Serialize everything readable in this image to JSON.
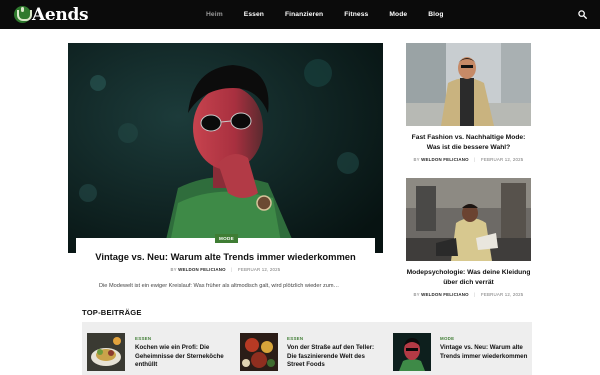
{
  "header": {
    "logo_text": "Aends",
    "nav": [
      "Heim",
      "Essen",
      "Finanzieren",
      "Fitness",
      "Mode",
      "Blog"
    ],
    "active_nav": "Heim"
  },
  "hero": {
    "category": "MODE",
    "title": "Vintage vs. Neu: Warum alte Trends immer wiederkommen",
    "author": "WELDON FELICIANO",
    "date": "FEBRUAR 12, 2025",
    "by": "BY",
    "excerpt": "Die Modewelt ist ein ewiger Kreislauf: Was früher als altmodisch galt, wird plötzlich wieder zum…"
  },
  "side_posts": [
    {
      "title": "Fast Fashion vs. Nachhaltige Mode: Was ist die bessere Wahl?",
      "by": "BY",
      "author": "WELDON FELICIANO",
      "date": "FEBRUAR 12, 2025"
    },
    {
      "title": "Modepsychologie: Was deine Kleidung über dich verrät",
      "by": "BY",
      "author": "WELDON FELICIANO",
      "date": "FEBRUAR 12, 2025"
    }
  ],
  "top_section": {
    "title": "TOP-BEITRÄGE",
    "items": [
      {
        "category": "ESSEN",
        "title": "Kochen wie ein Profi: Die Geheimnisse der Sterneköche enthüllt"
      },
      {
        "category": "ESSEN",
        "title": "Von der Straße auf den Teller: Die faszinierende Welt des Street Foods"
      },
      {
        "category": "MODE",
        "title": "Vintage vs. Neu: Warum alte Trends immer wiederkommen"
      }
    ]
  },
  "colors": {
    "header_bg": "#0b0b0b",
    "accent_green": "#3f7d34",
    "section_bg": "#eeeeee"
  }
}
